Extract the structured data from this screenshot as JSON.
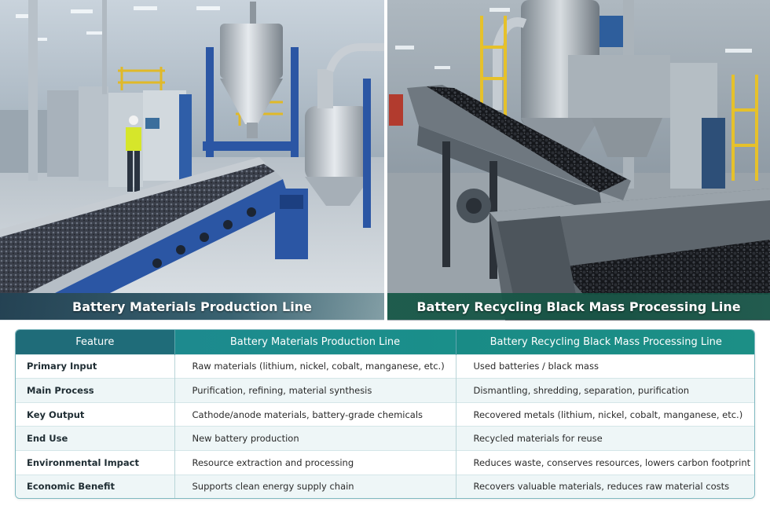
{
  "left_panel": {
    "caption": "Battery Materials Production Line"
  },
  "right_panel": {
    "caption": "Battery Recycling Black Mass Processing Line"
  },
  "comparison_table": {
    "headers": [
      "Feature",
      "Battery Materials Production Line",
      "Battery Recycling Black Mass Processing Line"
    ],
    "rows": [
      {
        "feature": "Primary Input",
        "production": "Raw materials (lithium, nickel, cobalt, manganese, etc.)",
        "recycling": "Used batteries / black mass"
      },
      {
        "feature": "Main Process",
        "production": "Purification, refining, material synthesis",
        "recycling": "Dismantling, shredding, separation, purification"
      },
      {
        "feature": "Key Output",
        "production": "Cathode/anode materials, battery-grade chemicals",
        "recycling": "Recovered metals (lithium, nickel, cobalt, manganese, etc.)"
      },
      {
        "feature": "End Use",
        "production": "New battery production",
        "recycling": "Recycled materials for reuse"
      },
      {
        "feature": "Environmental Impact",
        "production": "Resource extraction and processing",
        "recycling": "Reduces waste, conserves resources, lowers carbon footprint"
      },
      {
        "feature": "Economic Benefit",
        "production": "Supports clean energy supply chain",
        "recycling": "Recovers valuable materials, reduces raw material costs"
      }
    ]
  },
  "colors": {
    "header_dark": "#1f6c79",
    "header_teal": "#1a8f8a",
    "left_caption_bg": "#1b4557",
    "right_caption_bg": "#185848"
  }
}
